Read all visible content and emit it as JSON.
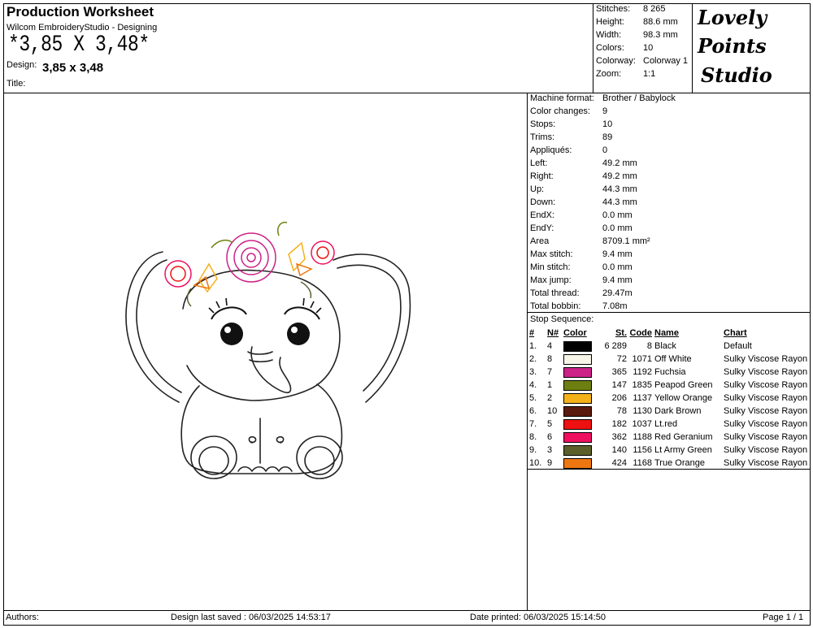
{
  "header": {
    "title": "Production Worksheet",
    "subtitle": "Wilcom EmbroideryStudio - Designing",
    "size_banner": "*3,85 X 3,48*",
    "design_label": "Design:",
    "design_value": "3,85 x 3,48",
    "title_label": "Title:"
  },
  "summary": [
    {
      "label": "Stitches:",
      "value": "8 265"
    },
    {
      "label": "Height:",
      "value": "88.6 mm"
    },
    {
      "label": "Width:",
      "value": "98.3 mm"
    },
    {
      "label": "Colors:",
      "value": "10"
    },
    {
      "label": "Colorway:",
      "value": "Colorway 1"
    },
    {
      "label": "Zoom:",
      "value": "1:1"
    }
  ],
  "logo": {
    "line1": "Lovely",
    "line2": "Points",
    "line3": "Studio"
  },
  "details": [
    {
      "label": "Machine format:",
      "value": "Brother / Babylock"
    },
    {
      "label": "Color changes:",
      "value": "9"
    },
    {
      "label": "Stops:",
      "value": "10"
    },
    {
      "label": "Trims:",
      "value": "89"
    },
    {
      "label": "Appliqués:",
      "value": "0"
    },
    {
      "label": "Left:",
      "value": "49.2 mm"
    },
    {
      "label": "Right:",
      "value": "49.2 mm"
    },
    {
      "label": "Up:",
      "value": "44.3 mm"
    },
    {
      "label": "Down:",
      "value": "44.3 mm"
    },
    {
      "label": "EndX:",
      "value": "0.0 mm"
    },
    {
      "label": "EndY:",
      "value": "0.0 mm"
    },
    {
      "label": "Area",
      "value": "8709.1 mm²"
    },
    {
      "label": "Max stitch:",
      "value": "9.4 mm"
    },
    {
      "label": "Min stitch:",
      "value": "0.0 mm"
    },
    {
      "label": "Max jump:",
      "value": "9.4 mm"
    },
    {
      "label": "Total thread:",
      "value": "29.47m"
    },
    {
      "label": "Total bobbin:",
      "value": "7.08m"
    }
  ],
  "stop_sequence": {
    "label": "Stop Sequence:",
    "headers": [
      "#",
      "N#",
      "Color",
      "St.",
      "Code",
      "Name",
      "Chart"
    ],
    "rows": [
      {
        "idx": "1.",
        "n": "4",
        "color": "#000000",
        "st": "6 289",
        "code": "8",
        "name": "Black",
        "chart": "Default"
      },
      {
        "idx": "2.",
        "n": "8",
        "color": "#f7f4e8",
        "st": "72",
        "code": "1071",
        "name": "Off White",
        "chart": "Sulky Viscose Rayon"
      },
      {
        "idx": "3.",
        "n": "7",
        "color": "#cc2288",
        "st": "365",
        "code": "1192",
        "name": "Fuchsia",
        "chart": "Sulky Viscose Rayon"
      },
      {
        "idx": "4.",
        "n": "1",
        "color": "#6e7f12",
        "st": "147",
        "code": "1835",
        "name": "Peapod Green",
        "chart": "Sulky Viscose Rayon"
      },
      {
        "idx": "5.",
        "n": "2",
        "color": "#f4b21a",
        "st": "206",
        "code": "1137",
        "name": "Yellow Orange",
        "chart": "Sulky Viscose Rayon"
      },
      {
        "idx": "6.",
        "n": "10",
        "color": "#5a1a0e",
        "st": "78",
        "code": "1130",
        "name": "Dark Brown",
        "chart": "Sulky Viscose Rayon"
      },
      {
        "idx": "7.",
        "n": "5",
        "color": "#ee1111",
        "st": "182",
        "code": "1037",
        "name": "Lt.red",
        "chart": "Sulky Viscose Rayon"
      },
      {
        "idx": "8.",
        "n": "6",
        "color": "#f01060",
        "st": "362",
        "code": "1188",
        "name": "Red Geranium",
        "chart": "Sulky Viscose Rayon"
      },
      {
        "idx": "9.",
        "n": "3",
        "color": "#5c5f2a",
        "st": "140",
        "code": "1156",
        "name": "Lt Army Green",
        "chart": "Sulky Viscose Rayon"
      },
      {
        "idx": "10.",
        "n": "9",
        "color": "#ee7711",
        "st": "424",
        "code": "1168",
        "name": "True Orange",
        "chart": "Sulky Viscose Rayon"
      }
    ]
  },
  "footer": {
    "authors": "Authors:",
    "saved": "Design last saved : 06/03/2025 14:53:17",
    "printed": "Date printed: 06/03/2025 15:14:50",
    "page": "Page 1 / 1"
  }
}
